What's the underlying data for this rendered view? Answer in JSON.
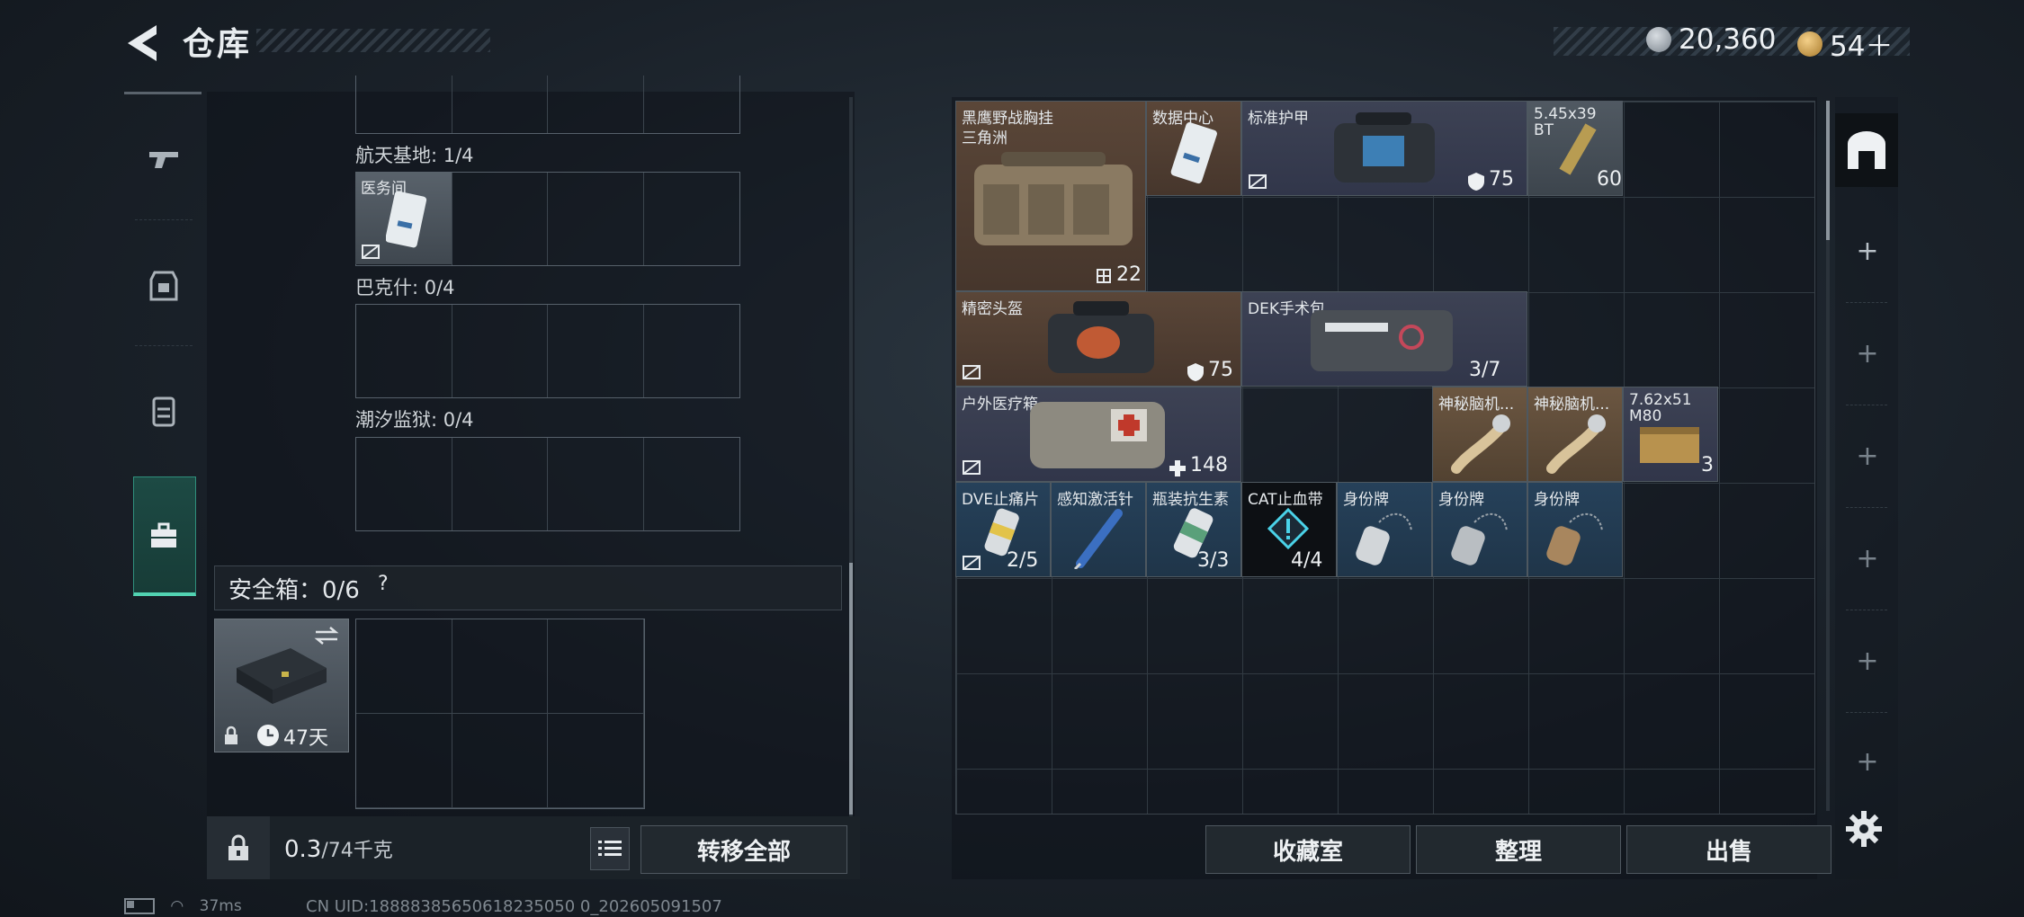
{
  "header": {
    "title": "仓库"
  },
  "currency": {
    "coins": "20,360",
    "tokens": "54＋"
  },
  "stash": {
    "sections": [
      {
        "label": "航天基地: 1/4",
        "item_label": "医务间"
      },
      {
        "label": "巴克什: 0/4"
      },
      {
        "label": "潮汐监狱: 0/4"
      }
    ],
    "safe_box": {
      "label": "安全箱：0/6",
      "help": "?",
      "days": "47天"
    },
    "weight": {
      "current": "0.3",
      "max": "/74千克"
    },
    "transfer_all": "转移全部"
  },
  "inventory": {
    "items": [
      {
        "label": "黑鹰野战胸挂",
        "sub": "三角洲",
        "value": "22"
      },
      {
        "label": "数据中心"
      },
      {
        "label": "标准护甲",
        "value": "75"
      },
      {
        "label": "5.45x39",
        "sub": "BT",
        "value": "60"
      },
      {
        "label": "精密头盔",
        "value": "75"
      },
      {
        "label": "DEK手术包",
        "value": "3/7"
      },
      {
        "label": "户外医疗箱",
        "value": "148"
      },
      {
        "label": "神秘脑机..."
      },
      {
        "label": "神秘脑机..."
      },
      {
        "label": "7.62x51",
        "sub": "M80",
        "value": "3"
      },
      {
        "label": "DVE止痛片",
        "value": "2/5"
      },
      {
        "label": "感知激活针"
      },
      {
        "label": "瓶装抗生素",
        "value": "3/3"
      },
      {
        "label": "CAT止血带",
        "value": "4/4"
      },
      {
        "label": "身份牌"
      },
      {
        "label": "身份牌"
      },
      {
        "label": "身份牌"
      }
    ]
  },
  "buttons": {
    "collection": "收藏室",
    "organize": "整理",
    "sell": "出售"
  },
  "status_bar": {
    "ping": "37ms",
    "uid": "CN UID:18888385650618235050 0_202605091507"
  }
}
